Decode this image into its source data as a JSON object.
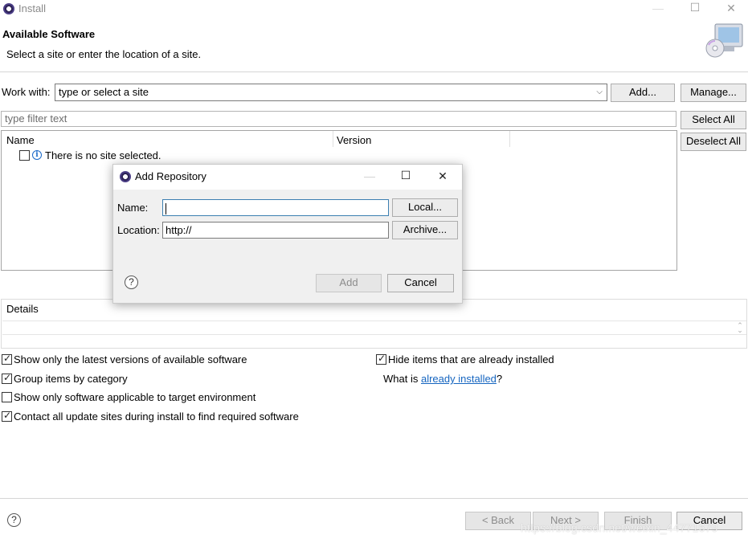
{
  "window": {
    "title": "Install",
    "min_glyph": "—",
    "max_glyph": "☐",
    "close_glyph": "✕"
  },
  "banner": {
    "title": "Available Software",
    "description": "Select a site or enter the location of a site."
  },
  "work_with": {
    "label": "Work with:",
    "value": "type or select a site",
    "add_label": "Add...",
    "manage_label": "Manage..."
  },
  "filter": {
    "placeholder": "type filter text",
    "select_all_label": "Select All",
    "deselect_all_label": "Deselect All"
  },
  "tree": {
    "columns": [
      "Name",
      "Version"
    ],
    "rows": [
      {
        "name": "There is no site selected.",
        "checked": false
      }
    ]
  },
  "details": {
    "label": "Details"
  },
  "options": {
    "left": [
      {
        "label": "Show only the latest versions of available software",
        "checked": true
      },
      {
        "label": "Group items by category",
        "checked": true
      },
      {
        "label": "Show only software applicable to target environment",
        "checked": false
      },
      {
        "label": "Contact all update sites during install to find required software",
        "checked": true
      }
    ],
    "hide_installed": {
      "label": "Hide items that are already installed",
      "checked": true
    },
    "what_is_prefix": "What is ",
    "what_is_link": "already installed",
    "what_is_suffix": "?"
  },
  "footer": {
    "help_glyph": "?",
    "back_label": "< Back",
    "next_label": "Next >",
    "finish_label": "Finish",
    "cancel_label": "Cancel",
    "watermark": "https://blog.csdn.net/weixin_44771679"
  },
  "dialog": {
    "title": "Add Repository",
    "name_label": "Name:",
    "name_value": "",
    "location_label": "Location:",
    "location_value": "http://",
    "local_label": "Local...",
    "archive_label": "Archive...",
    "add_label": "Add",
    "cancel_label": "Cancel",
    "help_glyph": "?",
    "min_glyph": "—",
    "max_glyph": "☐",
    "close_glyph": "✕"
  },
  "colors": {
    "link": "#1565c0",
    "dialog_bg": "#f0f0f0",
    "focus_border": "#3c7fb1"
  }
}
